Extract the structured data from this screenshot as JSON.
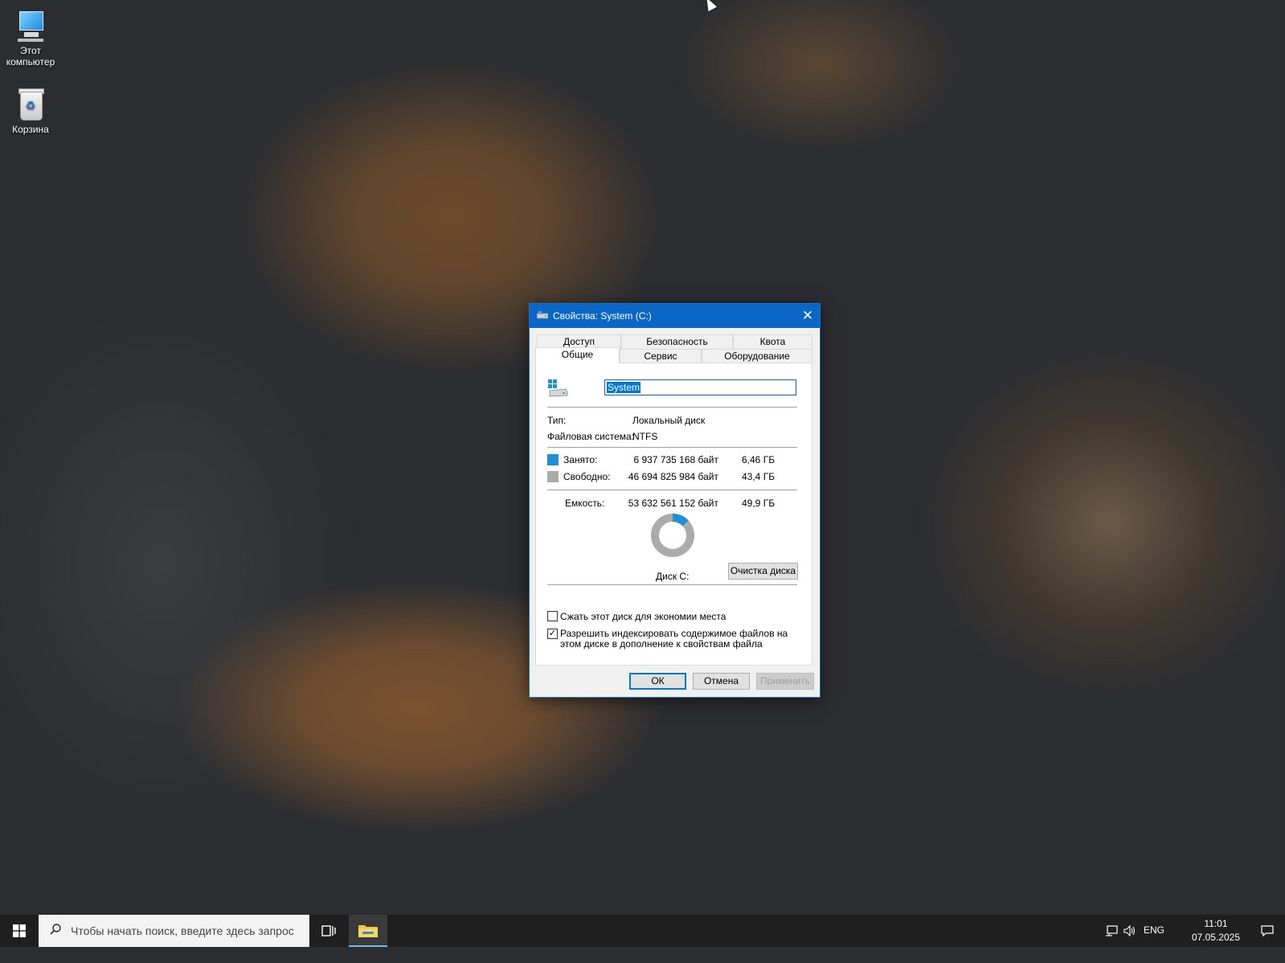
{
  "desktop": {
    "icons": [
      {
        "label": "Этот компьютер"
      },
      {
        "label": "Корзина"
      }
    ]
  },
  "dialog": {
    "title": "Свойства: System (C:)",
    "close_glyph": "✕",
    "tabs_row1": [
      "Доступ",
      "Безопасность",
      "Квота"
    ],
    "tabs_row2": [
      "Общие",
      "Сервис",
      "Оборудование"
    ],
    "active_tab": "Общие",
    "volume_name": "System",
    "type_label": "Тип:",
    "type_value": "Локальный диск",
    "fs_label": "Файловая система:",
    "fs_value": "NTFS",
    "used": {
      "label": "Занято:",
      "bytes": "6 937 735 168 байт",
      "size": "6,46 ГБ",
      "color": "#1e90d8"
    },
    "free": {
      "label": "Свободно:",
      "bytes": "46 694 825 984 байт",
      "size": "43,4 ГБ",
      "color": "#ababab"
    },
    "capacity": {
      "label": "Емкость:",
      "bytes": "53 632 561 152 байт",
      "size": "49,9 ГБ"
    },
    "drive_caption": "Диск C:",
    "cleanup_button": "Очистка диска",
    "compress_label": "Сжать этот диск для экономии места",
    "compress_checked": false,
    "index_label": "Разрешить индексировать содержимое файлов на этом диске в дополнение к свойствам файла",
    "index_checked": true,
    "ok_button": "ОК",
    "cancel_button": "Отмена",
    "apply_button": "Применить",
    "used_fraction": 0.1294
  },
  "taskbar": {
    "search_placeholder": "Чтобы начать поиск, введите здесь запрос",
    "lang": "ENG",
    "time": "11:01",
    "date": "07.05.2025"
  },
  "colors": {
    "accent": "#0b67c5",
    "taskbar": "#1f1f1f"
  }
}
